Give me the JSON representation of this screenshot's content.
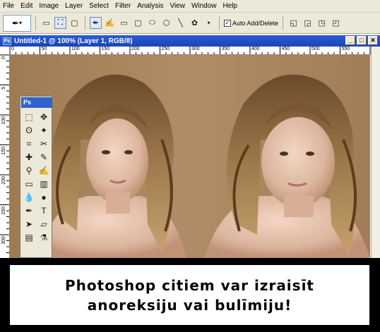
{
  "menu": [
    "File",
    "Edit",
    "Image",
    "Layer",
    "Select",
    "Filter",
    "Analysis",
    "View",
    "Window",
    "Help"
  ],
  "options_bar": {
    "tool_preset_icon": "pen-icon",
    "auto_add_delete_label": "Auto Add/Delete",
    "auto_add_delete_checked": true
  },
  "document": {
    "title": "Untitled-1 @ 100% (Layer 1, RGB/8)",
    "ruler_h_labels": [
      "0",
      "50",
      "100",
      "150",
      "200",
      "250",
      "300",
      "350",
      "400",
      "450",
      "500",
      "550"
    ],
    "ruler_v_labels": [
      "0",
      "5",
      "100",
      "150",
      "200",
      "250",
      "300",
      "350"
    ]
  },
  "toolbox": {
    "logo": "Ps",
    "tools": [
      "marquee-icon",
      "move-icon",
      "lasso-icon",
      "magic-wand-icon",
      "crop-icon",
      "slice-icon",
      "healing-brush-icon",
      "brush-icon",
      "clone-stamp-icon",
      "history-brush-icon",
      "eraser-icon",
      "gradient-icon",
      "blur-icon",
      "dodge-icon",
      "pen-icon",
      "type-icon",
      "path-select-icon",
      "shape-icon",
      "notes-icon",
      "eyedropper-icon"
    ],
    "tool_glyphs": [
      "⬚",
      "✥",
      "ʘ",
      "✦",
      "⌗",
      "✂",
      "✚",
      "✎",
      "⚲",
      "✍",
      "▭",
      "▥",
      "💧",
      "●",
      "✒",
      "T",
      "➤",
      "▱",
      "▤",
      "⚗"
    ]
  },
  "caption": {
    "line1": "Photoshop citiem var izraisīt",
    "line2": "anoreksiju vai bulīmiju!"
  },
  "colors": {
    "background": "#a8845d",
    "title_bar": "#2a5ad7",
    "menubar": "#ece9d8"
  }
}
